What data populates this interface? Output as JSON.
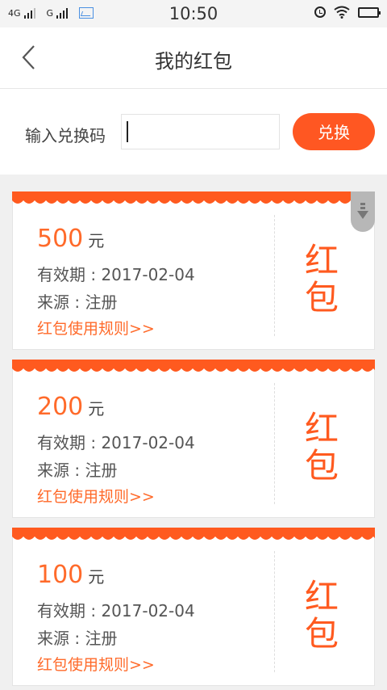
{
  "status_bar": {
    "network_1": "4G",
    "network_2": "G",
    "time": "10:50",
    "icons": [
      "signal-icon",
      "image-icon",
      "alarm-icon",
      "wifi-icon",
      "battery-icon"
    ]
  },
  "header": {
    "title": "我的红包",
    "back_icon": "chevron-left-icon"
  },
  "redeem": {
    "label": "输入兑换码",
    "input_value": "",
    "input_placeholder": "",
    "button_label": "兑换"
  },
  "coupons": [
    {
      "amount": "500",
      "unit": "元",
      "validity": "有效期 : 2017-02-04",
      "source": "来源 : 注册",
      "rules_link": "红包使用规则>>",
      "badge_line1": "红",
      "badge_line2": "包"
    },
    {
      "amount": "200",
      "unit": "元",
      "validity": "有效期 : 2017-02-04",
      "source": "来源 : 注册",
      "rules_link": "红包使用规则>>",
      "badge_line1": "红",
      "badge_line2": "包"
    },
    {
      "amount": "100",
      "unit": "元",
      "validity": "有效期 : 2017-02-04",
      "source": "来源 : 注册",
      "rules_link": "红包使用规则>>",
      "badge_line1": "红",
      "badge_line2": "包"
    }
  ],
  "colors": {
    "accent": "#ff5722",
    "amount": "#ff6a2a",
    "band": "#ff5a1f",
    "background": "#f0f0f0"
  }
}
